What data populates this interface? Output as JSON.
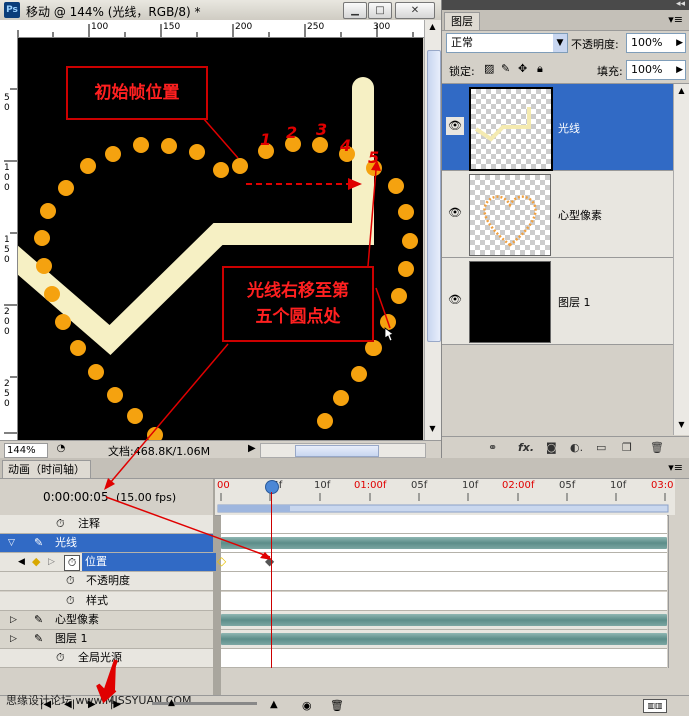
{
  "document": {
    "title": "移动 @ 144% (光线，RGB/8) *",
    "app_icon": "Ps",
    "ruler_top": [
      "100",
      "150",
      "200",
      "250",
      "300"
    ],
    "ruler_left": [
      "5\n0",
      "1\n0\n0",
      "1\n5\n0",
      "2\n0\n0",
      "2\n5\n0",
      "3\n0\n0"
    ],
    "zoom": "144%",
    "doc_size": "文档:468.8K/1.06M",
    "annotation_initial": "初始帧位置",
    "annotation_move": "光线右移至第\n五个圆点处",
    "dot_numbers": [
      "1",
      "2",
      "3",
      "4",
      "5"
    ]
  },
  "layers": {
    "tab": "图层",
    "blend_mode": "正常",
    "opacity_label": "不透明度:",
    "opacity_value": "100%",
    "lock_label": "锁定:",
    "fill_label": "填充:",
    "fill_value": "100%",
    "items": [
      {
        "name": "光线",
        "active": true
      },
      {
        "name": "心型像素",
        "active": false
      },
      {
        "name": "图层 1",
        "active": false
      }
    ]
  },
  "animation": {
    "tab": "动画（时间轴）",
    "timecode": "0:00:00:05",
    "fps": "(15.00 fps)",
    "ruler_labels": [
      "00",
      "05f",
      "10f",
      "01:00f",
      "05f",
      "10f",
      "02:00f",
      "05f",
      "10f",
      "03:0"
    ],
    "rows": [
      {
        "label": "注释",
        "kind": "prop"
      },
      {
        "label": "光线",
        "kind": "layer-open"
      },
      {
        "label": "位置",
        "kind": "prop-active"
      },
      {
        "label": "不透明度",
        "kind": "prop"
      },
      {
        "label": "样式",
        "kind": "prop"
      },
      {
        "label": "心型像素",
        "kind": "layer"
      },
      {
        "label": "图层 1",
        "kind": "layer"
      },
      {
        "label": "全局光源",
        "kind": "prop"
      }
    ],
    "footer_watermark": "思缘设计论坛 www.MISSYUAN.COM"
  },
  "colors": {
    "selection": "#316ac5",
    "dot": "#f5a010",
    "light_beam": "#f8f2c4",
    "annotation": "#e00000"
  }
}
